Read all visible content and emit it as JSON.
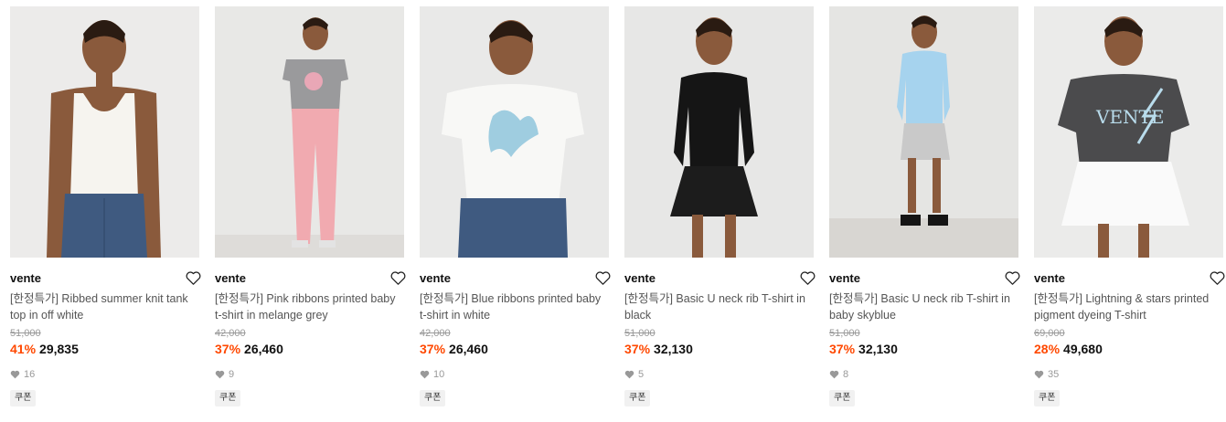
{
  "colors": {
    "discount": "#ff4800",
    "muted": "#999999",
    "coupon_bg": "#f1f1f1"
  },
  "products": [
    {
      "brand": "vente",
      "title": "[한정특가] Ribbed summer knit tank top in off white",
      "original_price": "51,000",
      "discount": "41%",
      "price": "29,835",
      "likes": "16",
      "badge": "쿠폰",
      "icons": [
        "heart-outline-icon",
        "heart-filled-icon"
      ]
    },
    {
      "brand": "vente",
      "title": "[한정특가] Pink ribbons printed baby t-shirt in melange grey",
      "original_price": "42,000",
      "discount": "37%",
      "price": "26,460",
      "likes": "9",
      "badge": "쿠폰",
      "icons": [
        "heart-outline-icon",
        "heart-filled-icon"
      ]
    },
    {
      "brand": "vente",
      "title": "[한정특가] Blue ribbons printed baby t-shirt in white",
      "original_price": "42,000",
      "discount": "37%",
      "price": "26,460",
      "likes": "10",
      "badge": "쿠폰",
      "icons": [
        "heart-outline-icon",
        "heart-filled-icon"
      ]
    },
    {
      "brand": "vente",
      "title": "[한정특가] Basic U neck rib T-shirt in black",
      "original_price": "51,000",
      "discount": "37%",
      "price": "32,130",
      "likes": "5",
      "badge": "쿠폰",
      "icons": [
        "heart-outline-icon",
        "heart-filled-icon"
      ]
    },
    {
      "brand": "vente",
      "title": "[한정특가] Basic U neck rib T-shirt in baby skyblue",
      "original_price": "51,000",
      "discount": "37%",
      "price": "32,130",
      "likes": "8",
      "badge": "쿠폰",
      "icons": [
        "heart-outline-icon",
        "heart-filled-icon"
      ]
    },
    {
      "brand": "vente",
      "title": "[한정특가] Lightning & stars printed pigment dyeing T-shirt",
      "original_price": "69,000",
      "discount": "28%",
      "price": "49,680",
      "likes": "35",
      "badge": "쿠폰",
      "icons": [
        "heart-outline-icon",
        "heart-filled-icon"
      ]
    }
  ]
}
